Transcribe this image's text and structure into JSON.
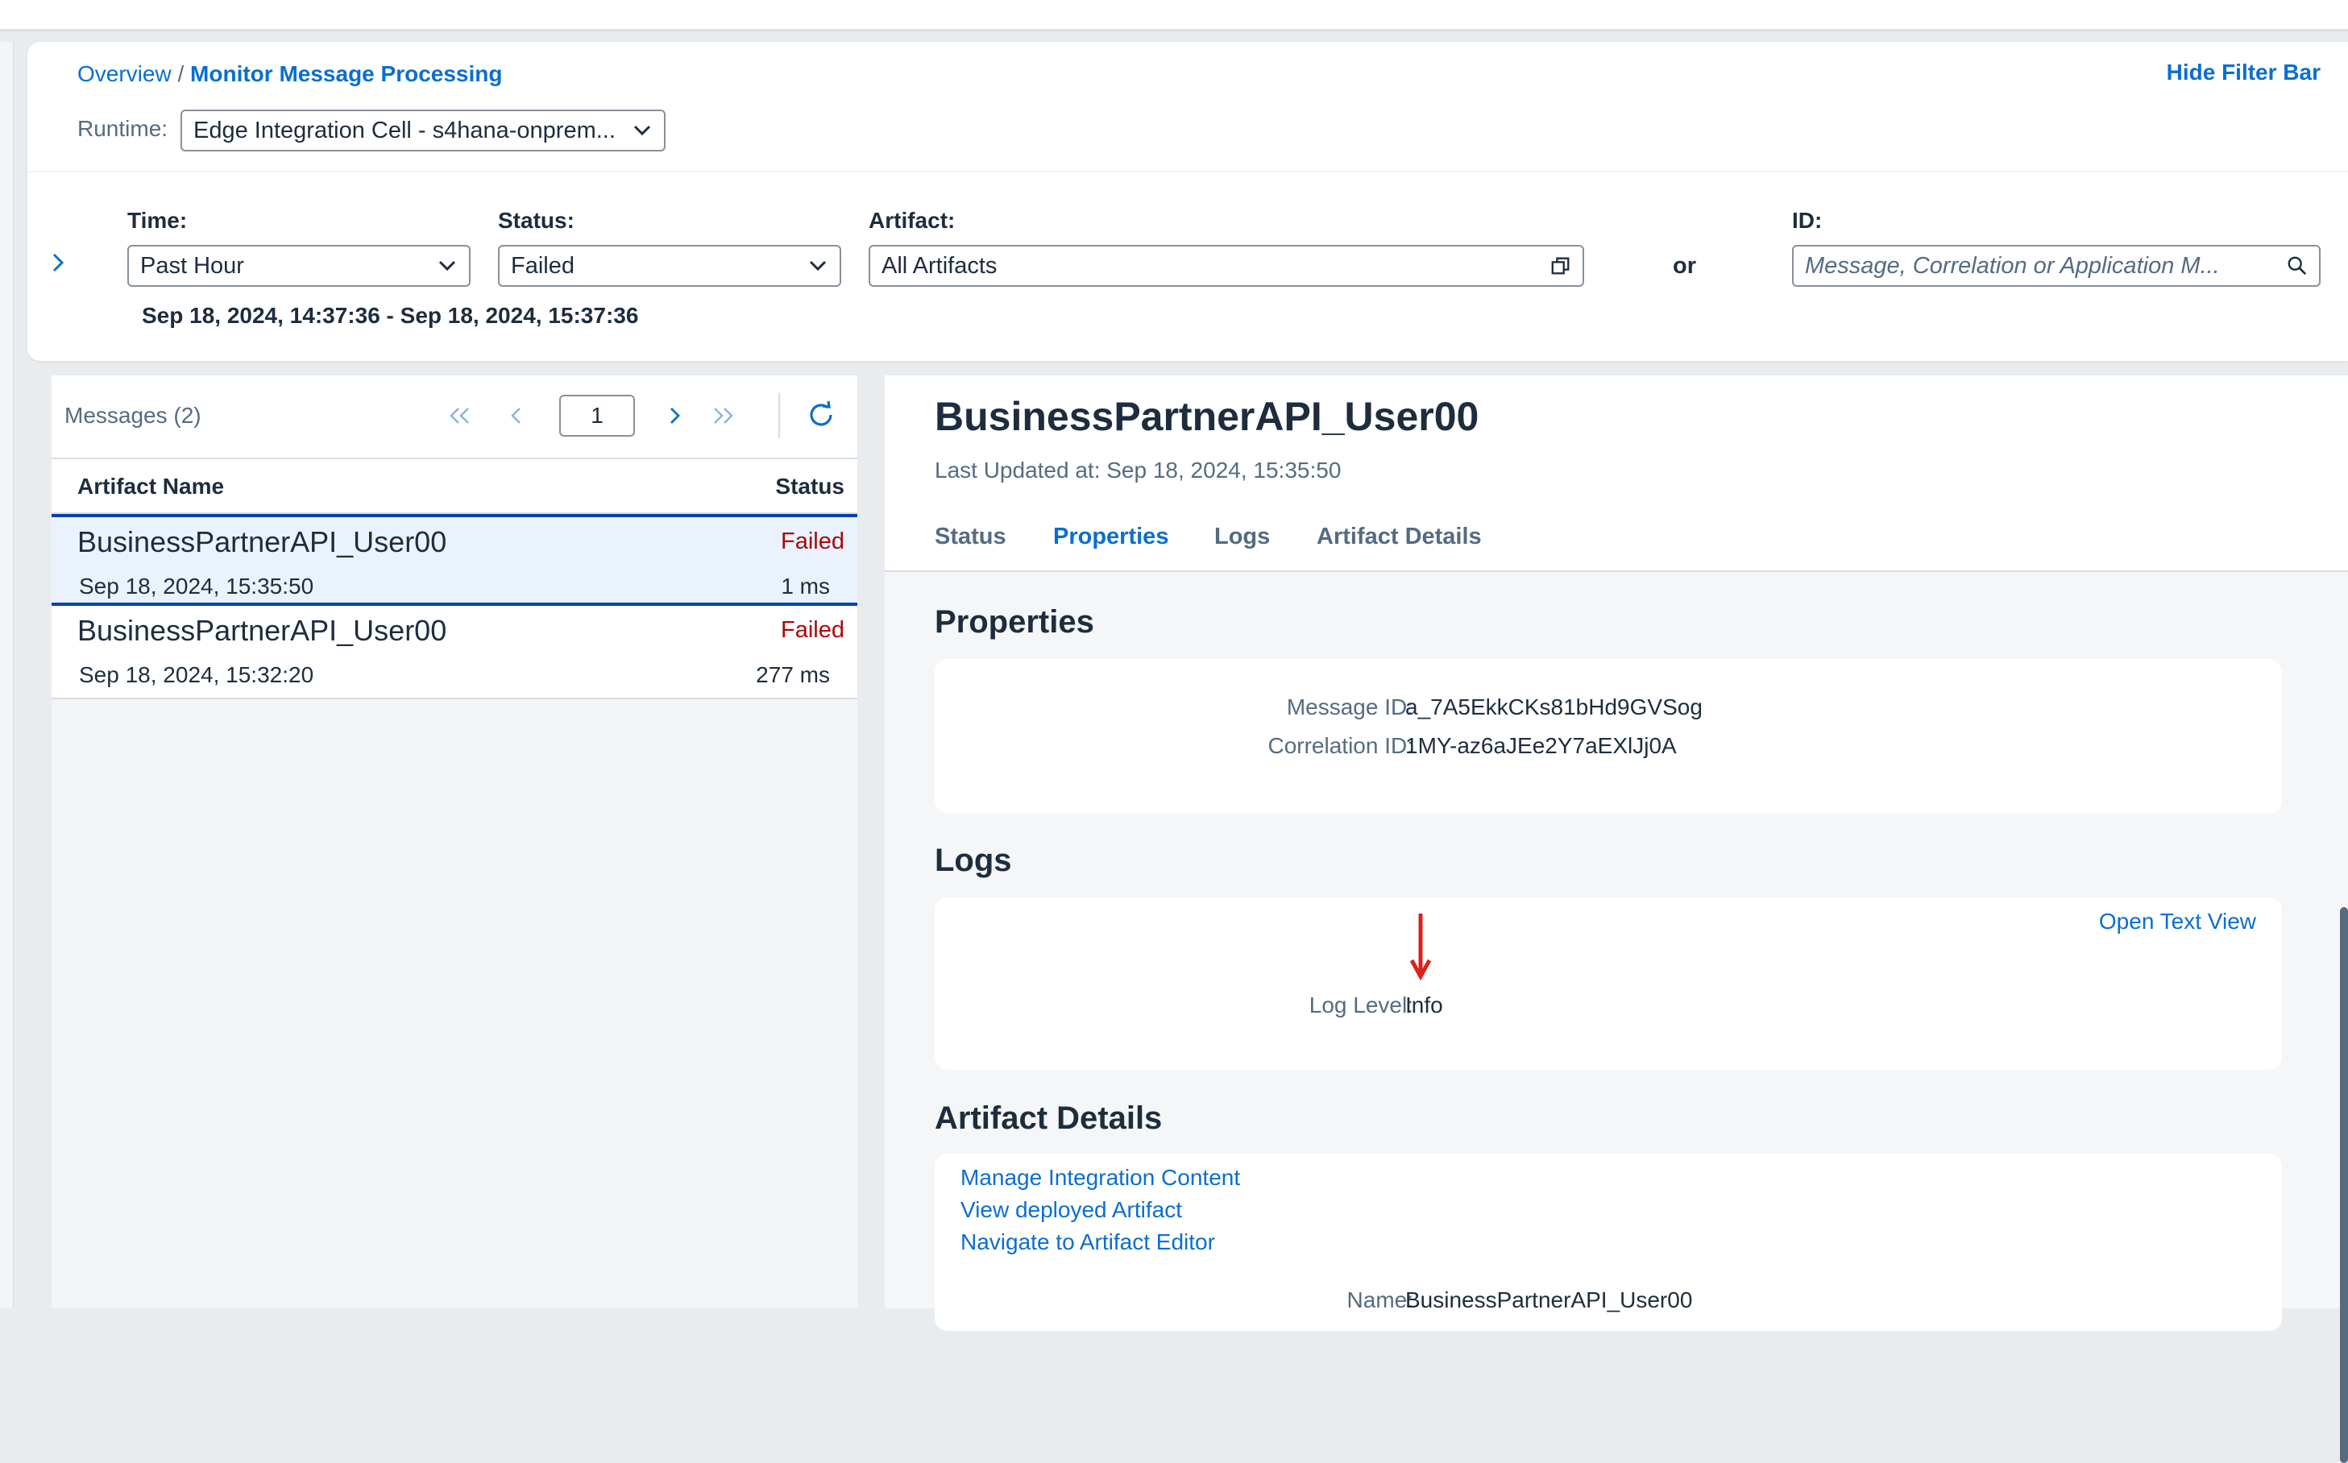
{
  "breadcrumb": {
    "root": "Overview",
    "separator": "/",
    "current": "Monitor Message Processing"
  },
  "header": {
    "hide_filter_bar": "Hide Filter Bar"
  },
  "runtime": {
    "label": "Runtime:",
    "value": "Edge Integration Cell - s4hana-onprem..."
  },
  "filters": {
    "time": {
      "label": "Time:",
      "value": "Past Hour"
    },
    "status": {
      "label": "Status:",
      "value": "Failed"
    },
    "artifact": {
      "label": "Artifact:",
      "value": "All Artifacts"
    },
    "or": "or",
    "id": {
      "label": "ID:",
      "placeholder": "Message, Correlation or Application M..."
    },
    "date_range": "Sep 18, 2024, 14:37:36 - Sep 18, 2024, 15:37:36"
  },
  "messages": {
    "title": "Messages (2)",
    "page": "1",
    "columns": {
      "artifact_name": "Artifact Name",
      "status": "Status"
    },
    "rows": [
      {
        "name": "BusinessPartnerAPI_User00",
        "status": "Failed",
        "date": "Sep 18, 2024, 15:35:50",
        "duration": "1 ms"
      },
      {
        "name": "BusinessPartnerAPI_User00",
        "status": "Failed",
        "date": "Sep 18, 2024, 15:32:20",
        "duration": "277 ms"
      }
    ]
  },
  "detail": {
    "title": "BusinessPartnerAPI_User00",
    "last_updated": "Last Updated at: Sep 18, 2024, 15:35:50",
    "tabs": [
      "Status",
      "Properties",
      "Logs",
      "Artifact Details"
    ],
    "active_tab": "Properties",
    "properties": {
      "title": "Properties",
      "message_id_label": "Message ID:",
      "message_id": "a_7A5EkkCKs81bHd9GVSog",
      "correlation_id_label": "Correlation ID:",
      "correlation_id": "1MY-az6aJEe2Y7aEXlJj0A"
    },
    "logs": {
      "title": "Logs",
      "open_text_view": "Open Text View",
      "log_level_label": "Log Level:",
      "log_level": "Info"
    },
    "artifact_details": {
      "title": "Artifact Details",
      "links": [
        "Manage Integration Content",
        "View deployed Artifact",
        "Navigate to Artifact Editor"
      ],
      "name_label": "Name:",
      "name": "BusinessPartnerAPI_User00"
    }
  },
  "colors": {
    "accent": "#0a6ed1",
    "error": "#aa0808",
    "selection": "#0040b0",
    "annotation_arrow": "#d9221c"
  }
}
